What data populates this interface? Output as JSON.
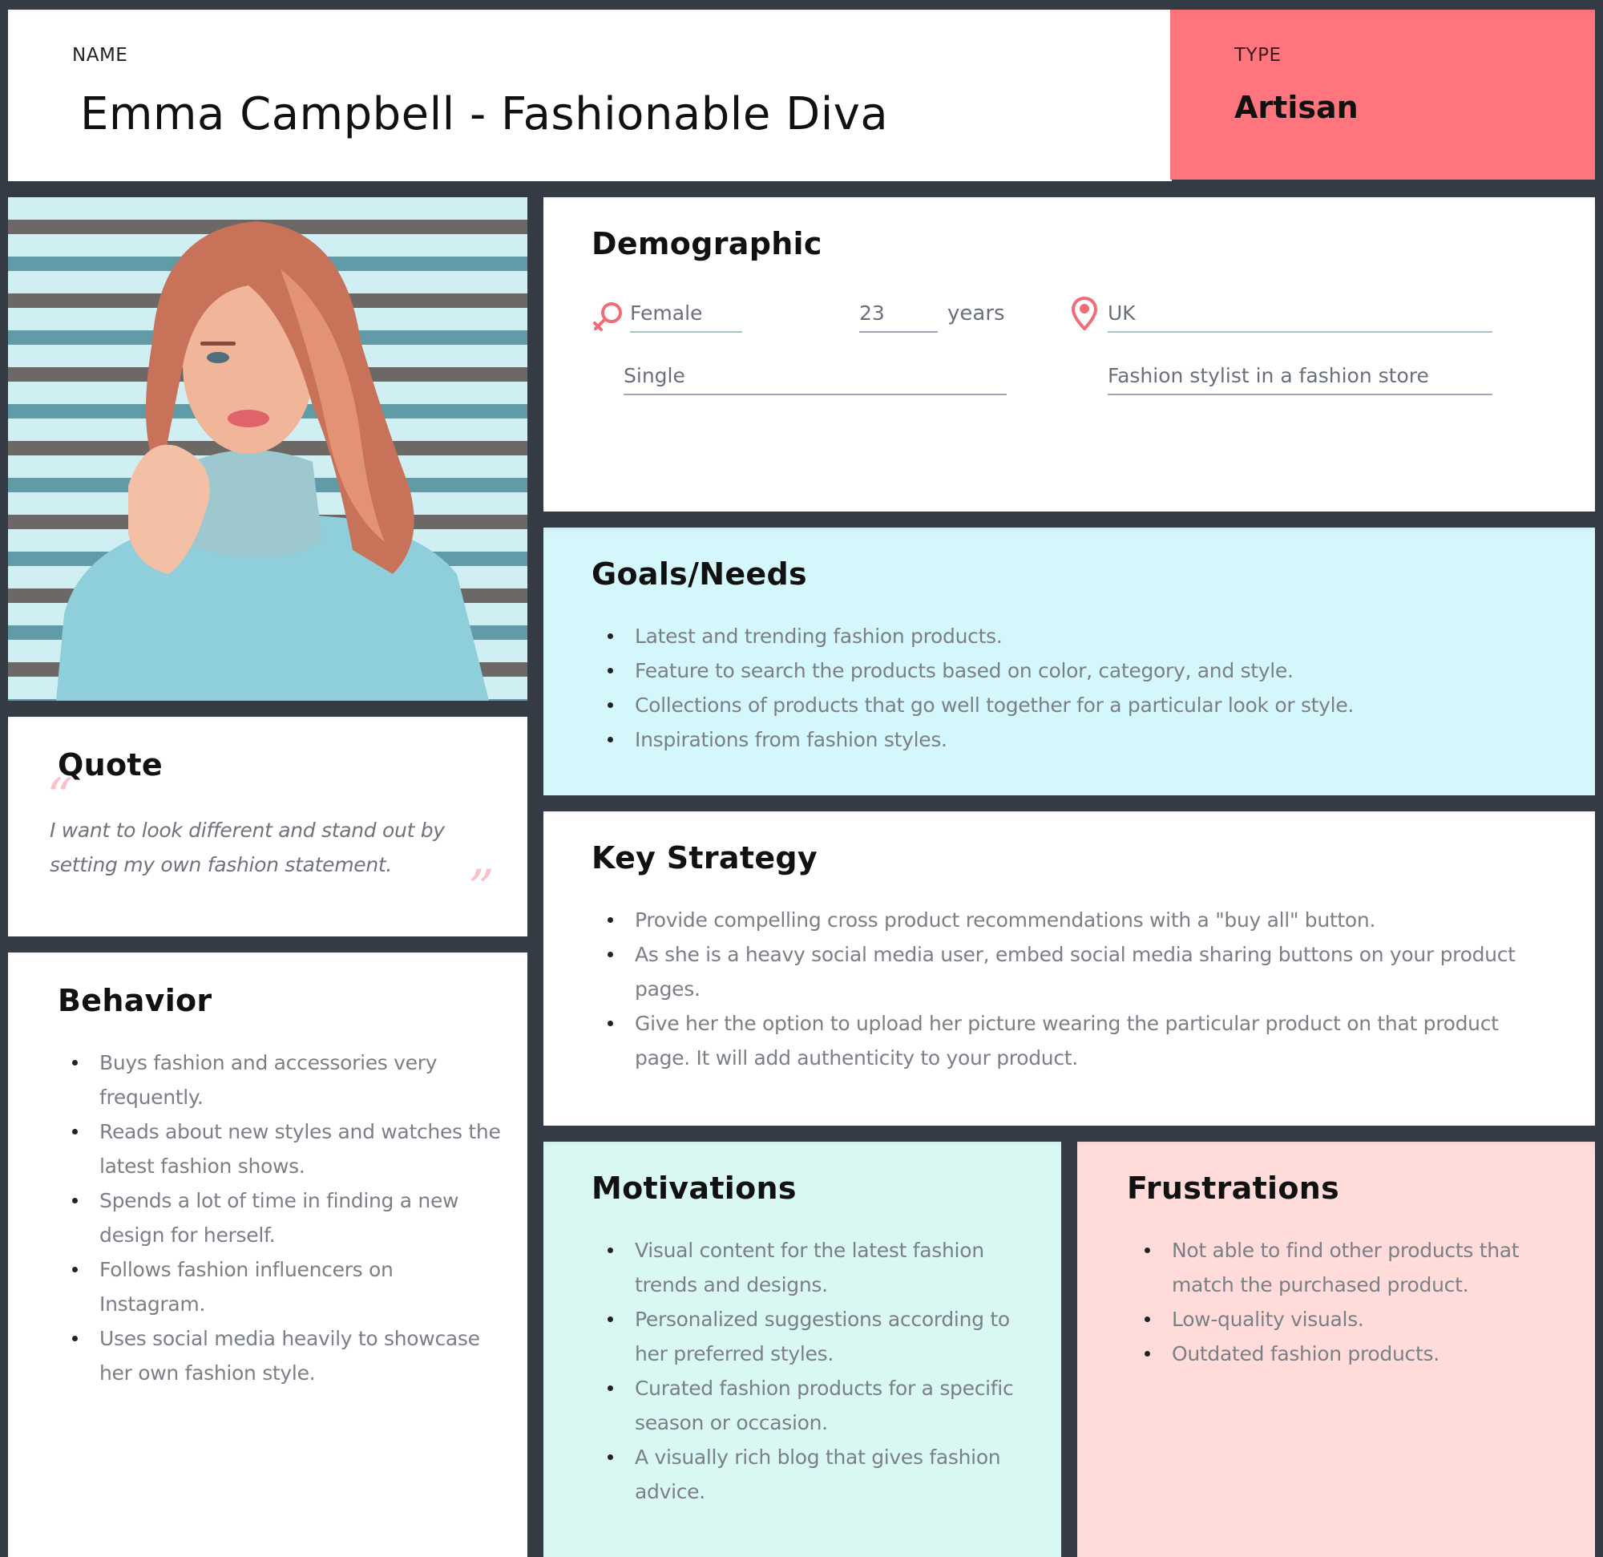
{
  "header": {
    "name_label": "NAME",
    "name_value": "Emma Campbell - Fashionable Diva",
    "type_label": "TYPE",
    "type_value": "Artisan"
  },
  "photo": {
    "alt": "Portrait of a woman with wavy auburn hair in a light blue turtleneck sweater against a striped wall"
  },
  "quote": {
    "heading": "Quote",
    "open_mark": "“",
    "text": "I want to look different and stand out by setting my own fashion statement.",
    "close_mark": "”"
  },
  "behavior": {
    "heading": "Behavior",
    "items": [
      "Buys fashion and accessories very frequently.",
      "Reads about new styles and watches the latest fashion shows.",
      "Spends a lot of time in finding a new design for herself.",
      "Follows fashion influencers on Instagram.",
      "Uses social media heavily to showcase her own fashion style."
    ]
  },
  "demographic": {
    "heading": "Demographic",
    "gender": "Female",
    "gender_icon": "female-symbol-icon",
    "age": "23",
    "age_unit": "years",
    "location": "UK",
    "location_icon": "map-pin-icon",
    "relationship_status": "Single",
    "occupation": "Fashion stylist in a fashion store"
  },
  "goals": {
    "heading": "Goals/Needs",
    "items": [
      "Latest and trending fashion products.",
      "Feature to search the products based on color, category, and style.",
      "Collections of products that go well together for a particular look or style.",
      "Inspirations from fashion styles."
    ]
  },
  "strategy": {
    "heading": "Key Strategy",
    "items": [
      "Provide compelling cross product recommendations with a \"buy all\" button.",
      "As she is a heavy social media user, embed social media sharing buttons on your product pages.",
      "Give her the option to upload her picture wearing the particular product on that product page. It will add authenticity to your product."
    ]
  },
  "motivations": {
    "heading": "Motivations",
    "items": [
      "Visual content for the latest fashion trends and designs.",
      "Personalized suggestions according to her preferred styles.",
      "Curated fashion products for a specific season or occasion.",
      "A visually rich blog that gives fashion advice."
    ]
  },
  "frustrations": {
    "heading": "Frustrations",
    "items": [
      "Not able to find other products that match the purchased product.",
      "Low-quality visuals.",
      "Outdated fashion products."
    ]
  },
  "colors": {
    "background": "#353b45",
    "type_accent": "#ff757d",
    "goals_bg": "#d4f7fb",
    "motivations_bg": "#d9f8f3",
    "frustrations_bg": "#ffdcda",
    "icon_accent": "#f26b75"
  }
}
